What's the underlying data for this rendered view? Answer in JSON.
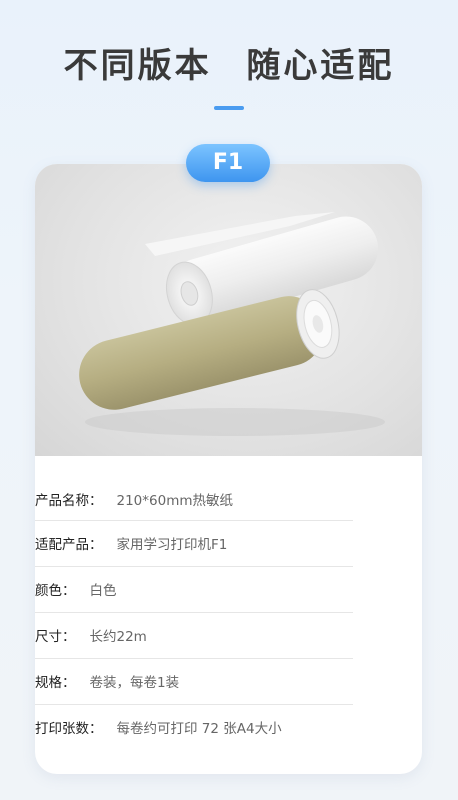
{
  "header": {
    "title": "不同版本  随心适配"
  },
  "badge": {
    "label": "F1"
  },
  "photo": {
    "subject": "thermal-paper-roll"
  },
  "specs": [
    {
      "label": "产品名称：",
      "value": "210*60mm热敏纸"
    },
    {
      "label": "适配产品：",
      "value": "家用学习打印机F1"
    },
    {
      "label": "颜色：",
      "value": "白色"
    },
    {
      "label": "尺寸：",
      "value": "长约22m"
    },
    {
      "label": "规格：",
      "value": "卷装，每卷1装"
    },
    {
      "label": "打印张数：",
      "value": "每卷约可打印 72 张A4大小"
    }
  ],
  "colors": {
    "accent": "#4a9cf0",
    "title": "#3a3a3a"
  }
}
